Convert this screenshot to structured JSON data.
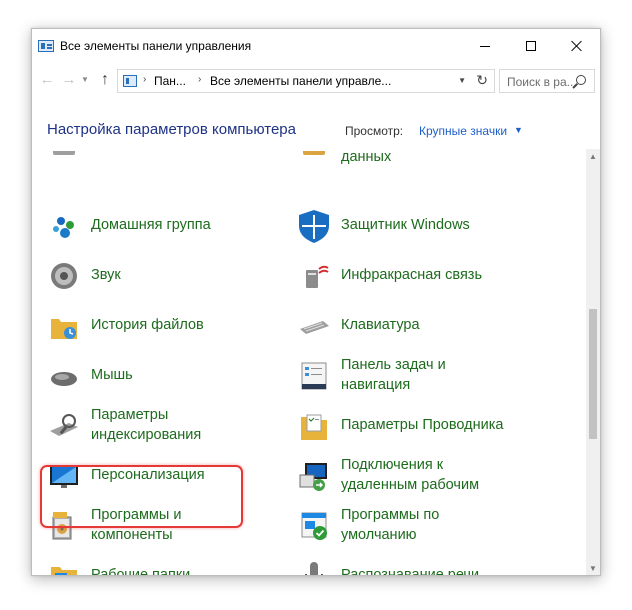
{
  "window": {
    "title": "Все элементы панели управления"
  },
  "titlebar": {
    "icon": "control-panel-icon",
    "buttons": [
      "minimize",
      "maximize",
      "close"
    ]
  },
  "nav": {
    "breadcrumb": [
      "Пан...",
      "Все элементы панели управле..."
    ],
    "search_placeholder": "Поиск в ра..."
  },
  "header": {
    "title": "Настройка параметров компьютера",
    "view_label": "Просмотр:",
    "view_value": "Крупные значки"
  },
  "items": [
    {
      "label_lines": [
        "данных"
      ],
      "icon": "data-icon"
    },
    {
      "label_lines": [
        "Домашняя группа"
      ],
      "icon": "homegroup-icon"
    },
    {
      "label_lines": [
        "Защитник Windows"
      ],
      "icon": "windows-defender-icon"
    },
    {
      "label_lines": [
        "Звук"
      ],
      "icon": "speaker-icon"
    },
    {
      "label_lines": [
        "Инфракрасная связь"
      ],
      "icon": "infrared-icon"
    },
    {
      "label_lines": [
        "История файлов"
      ],
      "icon": "file-history-icon"
    },
    {
      "label_lines": [
        "Клавиатура"
      ],
      "icon": "keyboard-icon"
    },
    {
      "label_lines": [
        "Мышь"
      ],
      "icon": "mouse-icon"
    },
    {
      "label_lines": [
        "Панель задач и",
        "навигация"
      ],
      "icon": "taskbar-icon"
    },
    {
      "label_lines": [
        "Параметры",
        "индексирования"
      ],
      "icon": "indexing-icon"
    },
    {
      "label_lines": [
        "Параметры Проводника"
      ],
      "icon": "explorer-options-icon"
    },
    {
      "label_lines": [
        "Персонализация"
      ],
      "icon": "personalization-icon"
    },
    {
      "label_lines": [
        "Подключения к",
        "удаленным рабочим"
      ],
      "icon": "remote-desktop-icon"
    },
    {
      "label_lines": [
        "Программы и",
        "компоненты"
      ],
      "icon": "programs-features-icon"
    },
    {
      "label_lines": [
        "Программы по",
        "умолчанию"
      ],
      "icon": "default-programs-icon"
    },
    {
      "label_lines": [
        "Рабочие папки"
      ],
      "icon": "work-folders-icon"
    },
    {
      "label_lines": [
        "Распознавание речи"
      ],
      "icon": "microphone-icon"
    }
  ],
  "colors": {
    "link_green": "#1d6b1d",
    "header_blue": "#1e3287",
    "view_blue": "#1f5fc9",
    "highlight_red": "#e53935"
  }
}
